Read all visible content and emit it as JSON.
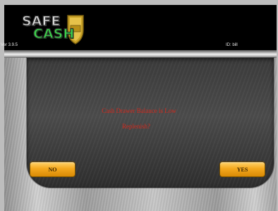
{
  "header": {
    "logo_word1": "SAFE",
    "logo_word2": "CASH",
    "version": "Ver 3.9.5",
    "user_id": "ID: bill"
  },
  "dialog": {
    "line1": "Cash Drawer Balance is Low",
    "line2": "Replenish?",
    "no_label": "NO",
    "yes_label": "YES"
  },
  "colors": {
    "message": "#d42a1e",
    "button": "#f4a81d",
    "logo_cash": "#3bd34a"
  }
}
